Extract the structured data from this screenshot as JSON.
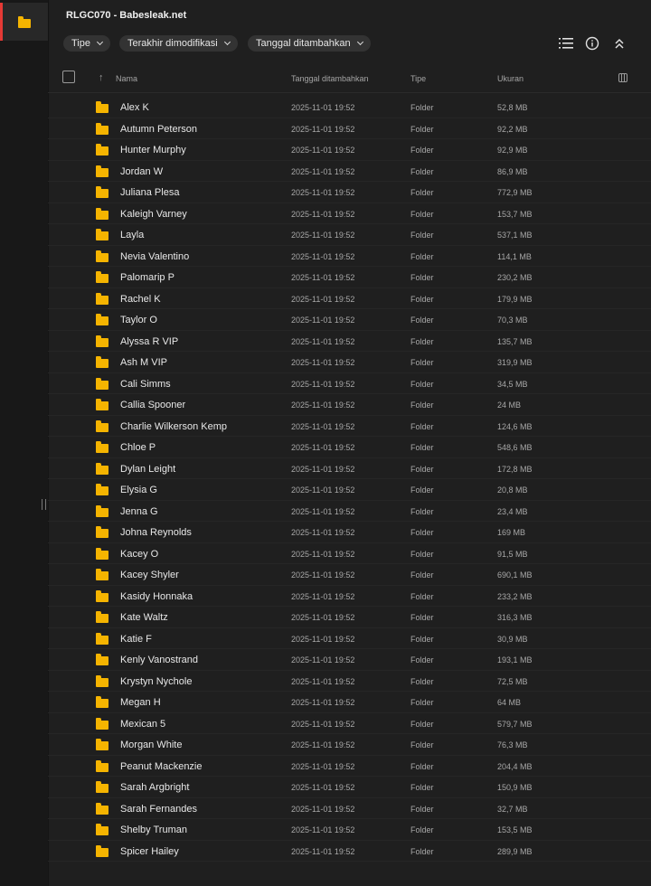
{
  "title": "RLGC070 - Babesleak.net",
  "rail": {
    "icon": "folder-icon",
    "accent": "#e53935"
  },
  "filters": [
    {
      "label": "Tipe"
    },
    {
      "label": "Terakhir dimodifikasi"
    },
    {
      "label": "Tanggal ditambahkan"
    }
  ],
  "toolbar_icons": [
    "list-view-icon",
    "info-icon",
    "collapse-icon"
  ],
  "columns": {
    "name": "Nama",
    "date": "Tanggal ditambahkan",
    "type": "Tipe",
    "size": "Ukuran"
  },
  "folder_color": "#f5b400",
  "rows": [
    {
      "name": "Alex K",
      "date": "2025-11-01 19:52",
      "type": "Folder",
      "size": "52,8 MB"
    },
    {
      "name": "Autumn Peterson",
      "date": "2025-11-01 19:52",
      "type": "Folder",
      "size": "92,2 MB"
    },
    {
      "name": "Hunter Murphy",
      "date": "2025-11-01 19:52",
      "type": "Folder",
      "size": "92,9 MB"
    },
    {
      "name": "Jordan W",
      "date": "2025-11-01 19:52",
      "type": "Folder",
      "size": "86,9 MB"
    },
    {
      "name": "Juliana Plesa",
      "date": "2025-11-01 19:52",
      "type": "Folder",
      "size": "772,9 MB"
    },
    {
      "name": "Kaleigh Varney",
      "date": "2025-11-01 19:52",
      "type": "Folder",
      "size": "153,7 MB"
    },
    {
      "name": "Layla",
      "date": "2025-11-01 19:52",
      "type": "Folder",
      "size": "537,1 MB"
    },
    {
      "name": "Nevia Valentino",
      "date": "2025-11-01 19:52",
      "type": "Folder",
      "size": "114,1 MB"
    },
    {
      "name": "Palomarip P",
      "date": "2025-11-01 19:52",
      "type": "Folder",
      "size": "230,2 MB"
    },
    {
      "name": "Rachel K",
      "date": "2025-11-01 19:52",
      "type": "Folder",
      "size": "179,9 MB"
    },
    {
      "name": "Taylor O",
      "date": "2025-11-01 19:52",
      "type": "Folder",
      "size": "70,3 MB"
    },
    {
      "name": "Alyssa R VIP",
      "date": "2025-11-01 19:52",
      "type": "Folder",
      "size": "135,7 MB"
    },
    {
      "name": "Ash M VIP",
      "date": "2025-11-01 19:52",
      "type": "Folder",
      "size": "319,9 MB"
    },
    {
      "name": "Cali Simms",
      "date": "2025-11-01 19:52",
      "type": "Folder",
      "size": "34,5 MB"
    },
    {
      "name": "Callia Spooner",
      "date": "2025-11-01 19:52",
      "type": "Folder",
      "size": "24 MB"
    },
    {
      "name": "Charlie Wilkerson Kemp",
      "date": "2025-11-01 19:52",
      "type": "Folder",
      "size": "124,6 MB"
    },
    {
      "name": "Chloe P",
      "date": "2025-11-01 19:52",
      "type": "Folder",
      "size": "548,6 MB"
    },
    {
      "name": "Dylan Leight",
      "date": "2025-11-01 19:52",
      "type": "Folder",
      "size": "172,8 MB"
    },
    {
      "name": "Elysia G",
      "date": "2025-11-01 19:52",
      "type": "Folder",
      "size": "20,8 MB"
    },
    {
      "name": "Jenna G",
      "date": "2025-11-01 19:52",
      "type": "Folder",
      "size": "23,4 MB"
    },
    {
      "name": "Johna Reynolds",
      "date": "2025-11-01 19:52",
      "type": "Folder",
      "size": "169 MB"
    },
    {
      "name": "Kacey O",
      "date": "2025-11-01 19:52",
      "type": "Folder",
      "size": "91,5 MB"
    },
    {
      "name": "Kacey Shyler",
      "date": "2025-11-01 19:52",
      "type": "Folder",
      "size": "690,1 MB"
    },
    {
      "name": "Kasidy Honnaka",
      "date": "2025-11-01 19:52",
      "type": "Folder",
      "size": "233,2 MB"
    },
    {
      "name": "Kate Waltz",
      "date": "2025-11-01 19:52",
      "type": "Folder",
      "size": "316,3 MB"
    },
    {
      "name": "Katie F",
      "date": "2025-11-01 19:52",
      "type": "Folder",
      "size": "30,9 MB"
    },
    {
      "name": "Kenly Vanostrand",
      "date": "2025-11-01 19:52",
      "type": "Folder",
      "size": "193,1 MB"
    },
    {
      "name": "Krystyn Nychole",
      "date": "2025-11-01 19:52",
      "type": "Folder",
      "size": "72,5 MB"
    },
    {
      "name": "Megan H",
      "date": "2025-11-01 19:52",
      "type": "Folder",
      "size": "64 MB"
    },
    {
      "name": "Mexican 5",
      "date": "2025-11-01 19:52",
      "type": "Folder",
      "size": "579,7 MB"
    },
    {
      "name": "Morgan White",
      "date": "2025-11-01 19:52",
      "type": "Folder",
      "size": "76,3 MB"
    },
    {
      "name": "Peanut Mackenzie",
      "date": "2025-11-01 19:52",
      "type": "Folder",
      "size": "204,4 MB"
    },
    {
      "name": "Sarah Argbright",
      "date": "2025-11-01 19:52",
      "type": "Folder",
      "size": "150,9 MB"
    },
    {
      "name": "Sarah Fernandes",
      "date": "2025-11-01 19:52",
      "type": "Folder",
      "size": "32,7 MB"
    },
    {
      "name": "Shelby Truman",
      "date": "2025-11-01 19:52",
      "type": "Folder",
      "size": "153,5 MB"
    },
    {
      "name": "Spicer Hailey",
      "date": "2025-11-01 19:52",
      "type": "Folder",
      "size": "289,9 MB"
    }
  ]
}
